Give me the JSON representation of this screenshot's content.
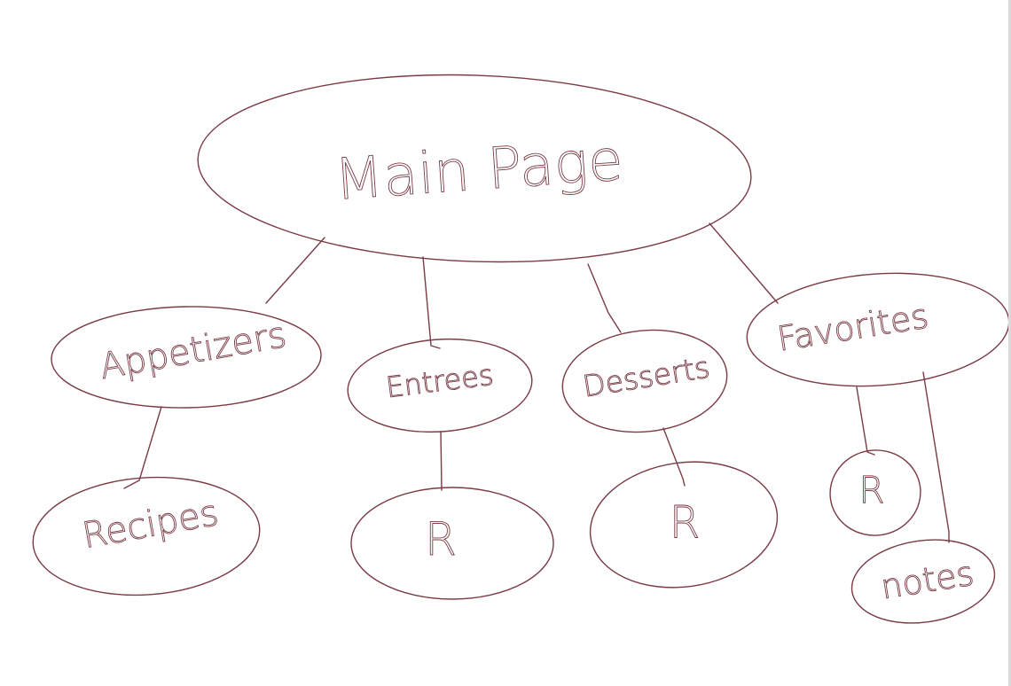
{
  "diagram": {
    "ink_color": "#7a3b45",
    "nodes": [
      {
        "id": "main",
        "label": "Main Page"
      },
      {
        "id": "app",
        "label": "Appetizers"
      },
      {
        "id": "ent",
        "label": "Entrees"
      },
      {
        "id": "des",
        "label": "Desserts"
      },
      {
        "id": "fav",
        "label": "Favorites"
      },
      {
        "id": "recipes",
        "label": "Recipes"
      },
      {
        "id": "ent-r",
        "label": "R"
      },
      {
        "id": "des-r",
        "label": "R"
      },
      {
        "id": "fav-r",
        "label": "R"
      },
      {
        "id": "notes",
        "label": "notes"
      }
    ],
    "edges": [
      {
        "from": "main",
        "to": "app"
      },
      {
        "from": "main",
        "to": "ent"
      },
      {
        "from": "main",
        "to": "des"
      },
      {
        "from": "main",
        "to": "fav"
      },
      {
        "from": "app",
        "to": "recipes"
      },
      {
        "from": "ent",
        "to": "ent-r"
      },
      {
        "from": "des",
        "to": "des-r"
      },
      {
        "from": "fav",
        "to": "fav-r"
      },
      {
        "from": "fav",
        "to": "notes"
      }
    ]
  }
}
